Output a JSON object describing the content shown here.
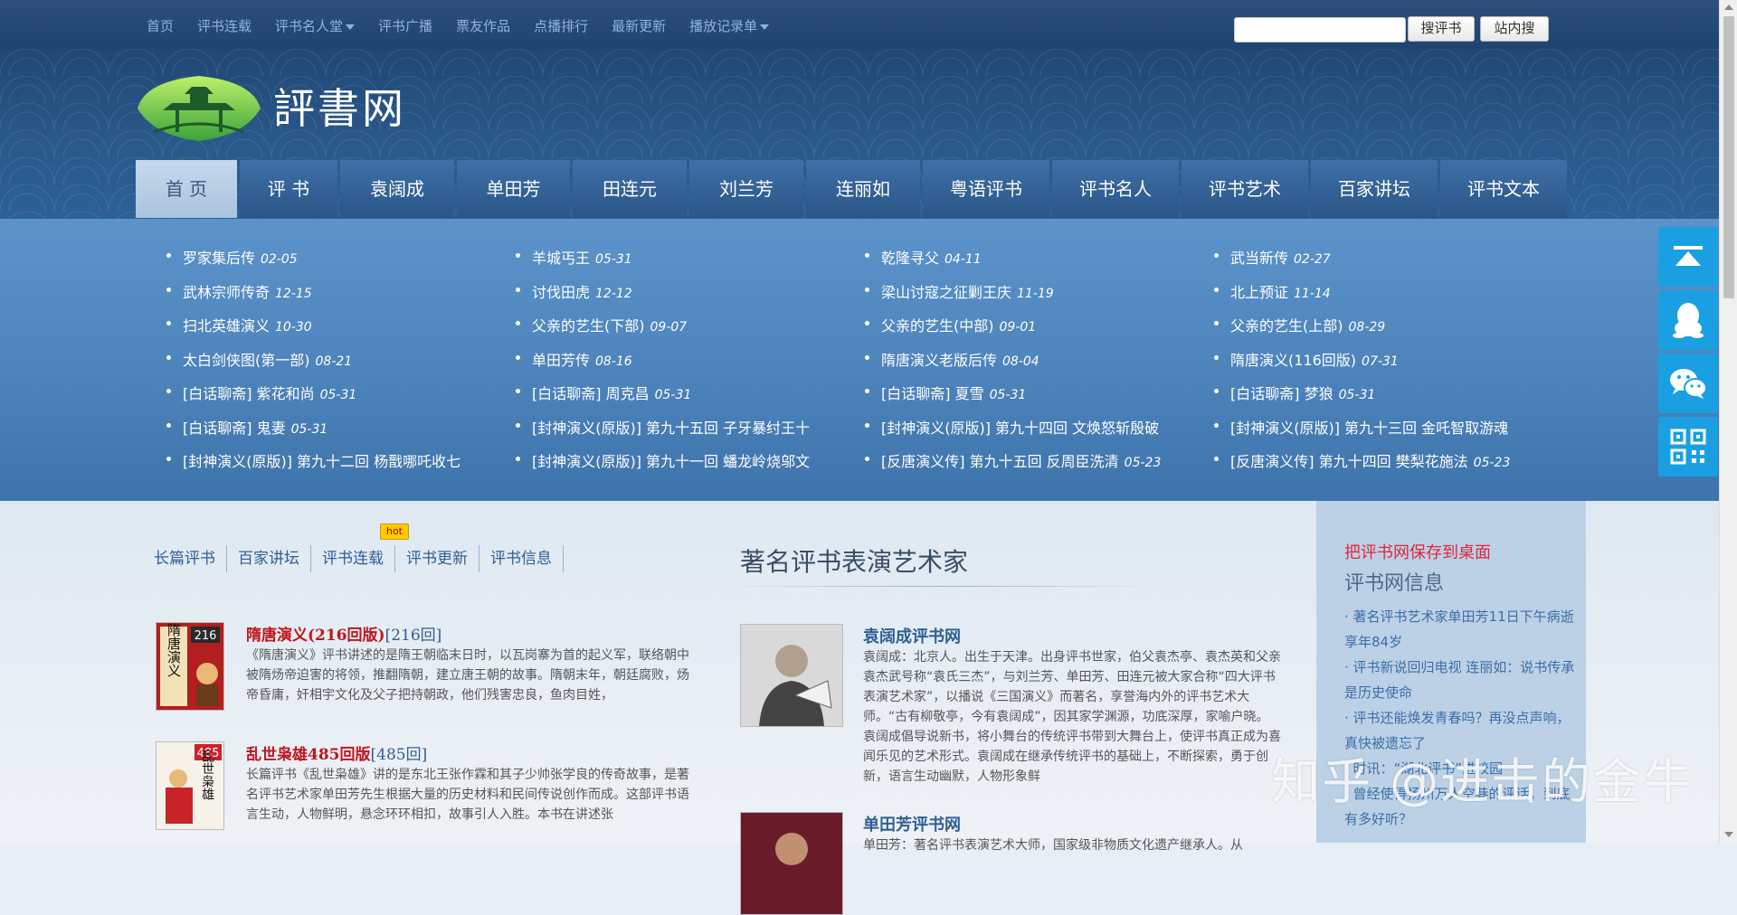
{
  "topnav": {
    "items": [
      "首页",
      "评书连载",
      "评书名人堂",
      "评书广播",
      "票友作品",
      "点播排行",
      "最新更新",
      "播放记录单"
    ],
    "search_btn": "搜评书",
    "site_search_btn": "站内搜"
  },
  "header": {
    "logo_text": "評書网"
  },
  "mainnav": {
    "tabs": [
      "首 页",
      "评 书",
      "袁阔成",
      "单田芳",
      "田连元",
      "刘兰芳",
      "连丽如",
      "粤语评书",
      "评书名人",
      "评书艺术",
      "百家讲坛",
      "评书文本"
    ]
  },
  "updates": {
    "col1": [
      {
        "t": "罗家集后传",
        "d": "02-05"
      },
      {
        "t": "武林宗师传奇",
        "d": "12-15"
      },
      {
        "t": "扫北英雄演义",
        "d": "10-30"
      },
      {
        "t": "太白剑侠图(第一部)",
        "d": "08-21"
      },
      {
        "t": "[白话聊斋] 紫花和尚",
        "d": "05-31"
      },
      {
        "t": "[白话聊斋] 鬼妻",
        "d": "05-31"
      },
      {
        "t": "[封神演义(原版)] 第九十二回  杨戬哪吒收七",
        "d": ""
      }
    ],
    "col2": [
      {
        "t": "羊城丐王",
        "d": "05-31"
      },
      {
        "t": "讨伐田虎",
        "d": "12-12"
      },
      {
        "t": "父亲的艺生(下部)",
        "d": "09-07"
      },
      {
        "t": "单田芳传",
        "d": "08-16"
      },
      {
        "t": "[白话聊斋] 周克昌",
        "d": "05-31"
      },
      {
        "t": "[封神演义(原版)] 第九十五回  子牙暴纣王十",
        "d": ""
      },
      {
        "t": "[封神演义(原版)] 第九十一回  蟠龙岭烧邬文",
        "d": ""
      }
    ],
    "col3": [
      {
        "t": "乾隆寻父",
        "d": "04-11"
      },
      {
        "t": "梁山讨寇之征剿王庆",
        "d": "11-19"
      },
      {
        "t": "父亲的艺生(中部)",
        "d": "09-01"
      },
      {
        "t": "隋唐演义老版后传",
        "d": "08-04"
      },
      {
        "t": "[白话聊斋] 夏雪",
        "d": "05-31"
      },
      {
        "t": "[封神演义(原版)] 第九十四回  文焕怒斩殷破",
        "d": ""
      },
      {
        "t": "[反唐演义传] 第九十五回  反周臣洗清",
        "d": "05-23"
      }
    ],
    "col4": [
      {
        "t": "武当新传",
        "d": "02-27"
      },
      {
        "t": "北上预证",
        "d": "11-14"
      },
      {
        "t": "父亲的艺生(上部)",
        "d": "08-29"
      },
      {
        "t": "隋唐演义(116回版)",
        "d": "07-31"
      },
      {
        "t": "[白话聊斋] 梦狼",
        "d": "05-31"
      },
      {
        "t": "[封神演义(原版)] 第九十三回  金吒智取游魂",
        "d": ""
      },
      {
        "t": "[反唐演义传] 第九十四回  樊梨花施法",
        "d": "05-23"
      }
    ]
  },
  "subtabs": [
    "长篇评书",
    "百家讲坛",
    "评书连载",
    "评书更新",
    "评书信息"
  ],
  "hot_badge": "hot",
  "books": [
    {
      "title": "隋唐演义(216回版)",
      "count": "[216回]",
      "cover_num": "216",
      "cover_text": "隋唐演义",
      "desc": "《隋唐演义》评书讲述的是隋王朝临末日时，以瓦岗寨为首的起义军，联络朝中被隋炀帝迫害的将领，推翻隋朝，建立唐王朝的故事。隋朝末年，朝廷腐败，炀帝昏庸，奸相宇文化及父子把持朝政，他们残害忠良，鱼肉目姓，"
    },
    {
      "title": "乱世枭雄485回版",
      "count": "[485回]",
      "cover_num": "485",
      "cover_text": "乱世枭雄",
      "desc": "长篇评书《乱世枭雄》讲的是东北王张作霖和其子少帅张学良的传奇故事，是著名评书艺术家单田芳先生根据大量的历史材料和民间传说创作而成。这部评书语言生动，人物鲜明，悬念环环相扣，故事引人入胜。本书在讲述张"
    }
  ],
  "artists_section": {
    "title": "著名评书表演艺术家",
    "artists": [
      {
        "name": "袁阔成评书网",
        "desc": "袁阔成：北京人。出生于天津。出身评书世家，伯父袁杰亭、袁杰英和父亲袁杰武号称“袁氏三杰”，与刘兰芳、单田芳、田连元被大家合称“四大评书表演艺术家”，以播说《三国演义》而著名，享誉海内外的评书艺术大师。“古有柳敬亭，今有袁阔成”，因其家学渊源，功底深厚，家喻户晓。袁阔成倡导说新书，将小舞台的传统评书带到大舞台上，使评书真正成为喜闻乐见的艺术形式。袁阔成在继承传统评书的基础上，不断探索，勇于创新，语言生动幽默，人物形象鲜"
      },
      {
        "name": "单田芳评书网",
        "desc": "单田芳：著名评书表演艺术大师，国家级非物质文化遗产继承人。从"
      }
    ]
  },
  "rightbox": {
    "save_link": "把评书网保存到桌面",
    "title": "评书网信息",
    "news": [
      "·  著名评书艺术家单田芳11日下午病逝 享年84岁",
      "· 评书新说回归电视 连丽如：说书传承是历史使命",
      "· 评书还能焕发青春吗？再没点声响，真快被遗忘了",
      "· 时讯：“湖北评书”进校园",
      "· 曾经使得扬州万人空巷的评话，到底有多好听？"
    ]
  },
  "watermark": "知乎 @进击的金牛",
  "colors": {
    "accent_blue": "#2f5f94",
    "title_red": "#c0161b",
    "float_btn": "#1aa0e2"
  },
  "icons": [
    "back-to-top-icon",
    "qq-icon",
    "wechat-icon",
    "qrcode-icon"
  ]
}
